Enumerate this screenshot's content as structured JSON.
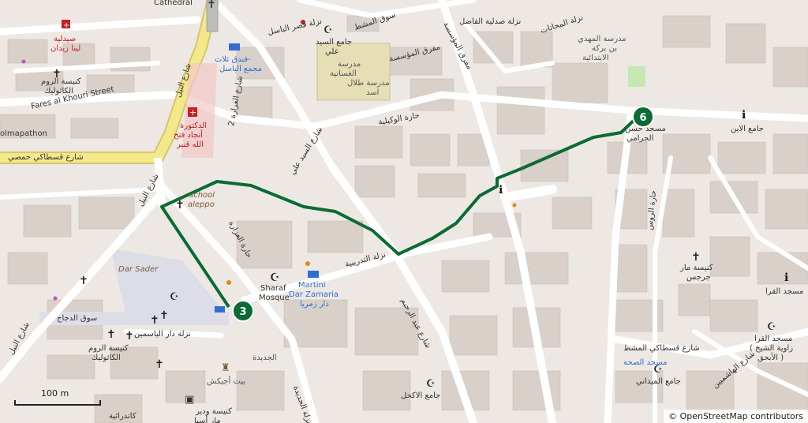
{
  "map": {
    "route_color": "#0a6b34",
    "markers": [
      {
        "label": "3"
      },
      {
        "label": "6"
      }
    ],
    "scale_label": "100 m",
    "attribution": "© OpenStreetMap contributors",
    "labels": {
      "cathedral": "Cathedral",
      "naslat_qasr_albasil": "نزلة قصر الباسل",
      "souq_almushat": "سوق المشط",
      "naslat_saydaliat_alfadil": "نزلة صدلية الفاضل",
      "naslat_almahatat": "نزلة المحاتات",
      "madrasa_almahdi_1": "مدرسة المهدي",
      "madrasa_almahdi_2": "بن بركة",
      "madrasa_almahdi_3": "الابتدائية",
      "jami_alsayyid_1": "جامع السيد",
      "jami_alsayyid_2": "علي",
      "mafraq_almuassasa": "مفرق المؤسسة",
      "madrasa_ghassania_1": "مدرسة",
      "madrasa_ghassania_2": "الغسانية",
      "madrasa_talal_1": "مدرسة طلال",
      "madrasa_talal_2": "اسد",
      "saydaliat_lina_1": "صيدلية",
      "saydaliat_lina_2": "لينا زيدان",
      "kanisat_alroum_1": "كنيسة الروم",
      "kanisat_alroum_2": "الكاثوليك",
      "funduq_1": "فندق ثلاث-",
      "funduq_2": "مجمع الباسل",
      "fares_street": "Fares al Khouri Street",
      "sharia_alnil_top": "شارع النيل",
      "duktura_1": "الدكتورة",
      "duktura_2": "أنجاد فتح",
      "duktura_3": "الله قنبر",
      "olmapathon": "olmapathon",
      "sharia_qustaki": "شارع قسطاكي حمصي",
      "sharia_alazara": "شارع العزارة 2",
      "hara_alwakilia": "حارة الوكيلية",
      "sharia_alsayyid_ali": "شارع السيد علي",
      "masjid_aljurami_1": "مسجد حسن",
      "masjid_aljurami_2": "الجرامي",
      "jami_alain": "جامع الاين",
      "school_1": "school",
      "school_2": "aleppo",
      "sharia_alnil_left": "شارع النيل",
      "hara_alazara": "حارة العزارة",
      "dar_sader": "Dar Sader",
      "souq_aldajjaj": "سوق الدجاج",
      "sharaf_1": "Sharaf",
      "sharaf_2": "Mosque",
      "martini_1": "Martini",
      "martini_2": "Dar Zamaria",
      "martini_3": "دار زمريا",
      "nazlat_altadribia": "نزلة التدريبية",
      "sharia_abd_alrahim": "شارع عبد الرحيم",
      "hara_alrouss": "حارة الروس",
      "kanisat_mar_1": "كنيسة مار",
      "kanisat_mar_2": "جرجس",
      "masjid_alqarra": "مسجد القرا",
      "masjid_alqarra2_1": "مسجد القرا",
      "masjid_alqarra2_2": "( زاوية الشيخ",
      "masjid_alqarra2_3": "الأبحق )",
      "nazlat_dar_alyasamin": "نزلة دار الياسمين",
      "kanisat_alroum2_1": "كنيسة الروم",
      "kanisat_alroum2_2": "الكاثوليك",
      "aljadida": "الجديدة",
      "bayt_ajiksh": "بيت أجيكش",
      "naslat_aljadida": "نزلة الجديدة",
      "jami_alakhal": "جامع الاكحل",
      "sharia_qustaki2": "شارع قسطاكي المشط",
      "masjid_alsahha": "مسجد الصحة",
      "jami_almaydani": "جامع الميداني",
      "sharia_alhashimiyeen": "شارع الهاشميين",
      "sharia_alnil_bottom": "شارع النيل",
      "kanisat_wadir_1": "كنيسة ودير",
      "kanisat_wadir_2": "مار أسيا",
      "katidraiya": "كاتدرائية"
    }
  }
}
